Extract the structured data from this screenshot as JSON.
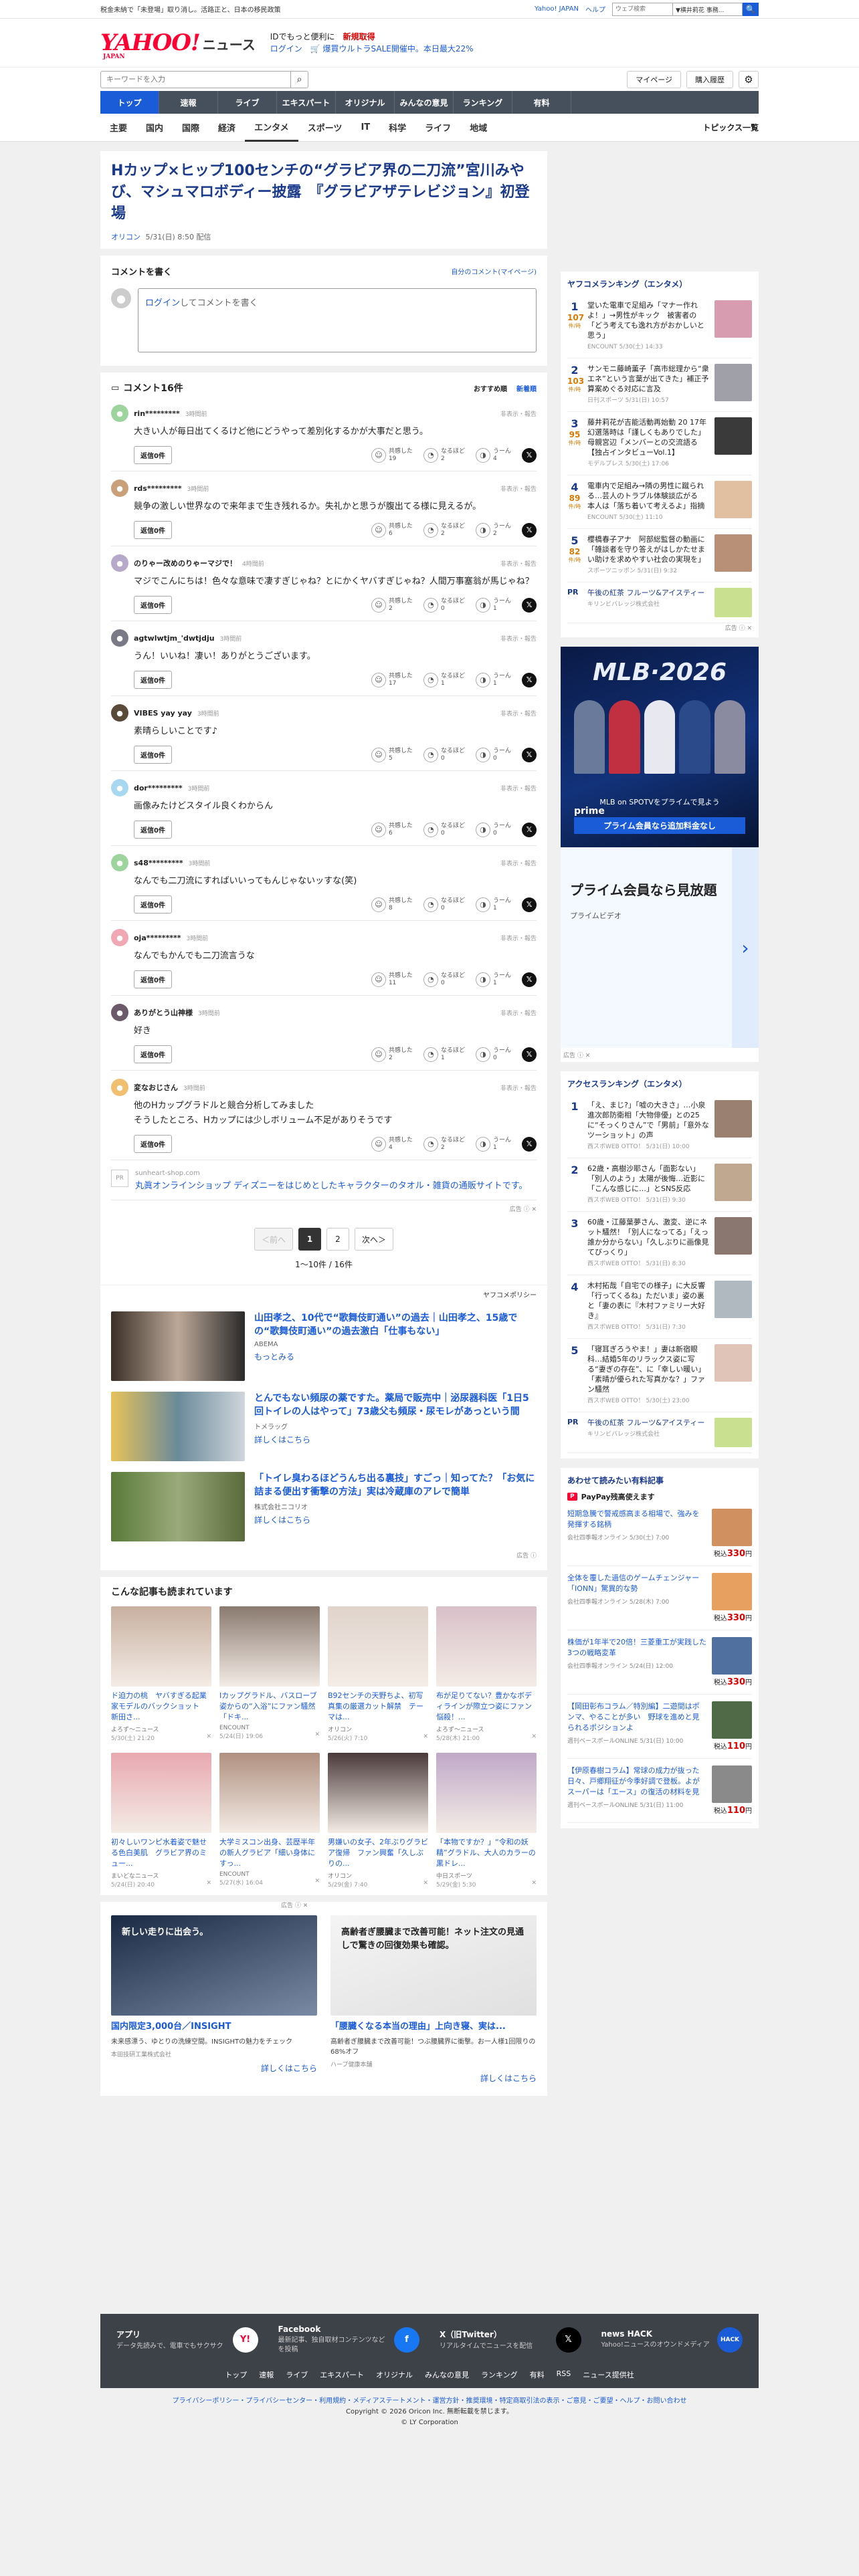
{
  "topbar": {
    "promo": "税金未納で「未登場」取り消し。活路正と、日本の移民政策",
    "links": [
      "Yahoo! JAPAN",
      "ヘルプ"
    ],
    "search_placeholder": "ウェブ検索",
    "search_scope": "▼横井莉花 事務...",
    "search_button": "🔍"
  },
  "header": {
    "logo_yahoo": "YAHOO!",
    "logo_japan": "JAPAN",
    "logo_news": "ニュース",
    "ad_line1_a": "IDでもっと便利に",
    "ad_line1_b": "新規取得",
    "ad_line2_a": "ログイン",
    "ad_line2_b": "🛒 爆買ウルトラSALE開催中。本日最大22%"
  },
  "searchrow": {
    "placeholder": "キーワードを入力",
    "mypage": "マイページ",
    "history": "購入履歴",
    "gear": "⚙"
  },
  "nav": {
    "tabs": [
      "トップ",
      "速報",
      "ライブ",
      "エキスパート",
      "オリジナル",
      "みんなの意見",
      "ランキング",
      "有料"
    ],
    "sub": [
      "主要",
      "国内",
      "国際",
      "経済",
      "エンタメ",
      "スポーツ",
      "IT",
      "科学",
      "ライフ",
      "地域"
    ],
    "topics": "トピックス一覧"
  },
  "article": {
    "title": "Hカップ×ヒップ100センチの“グラビア界の二刀流”宮川みやび、マシュマロボディー披露　『グラビアザテレビジョン』初登場",
    "source": "オリコン",
    "date": "5/31(日) 8:50 配信"
  },
  "commentbox": {
    "title": "コメントを書く",
    "mine": "自分のコメント(マイページ)",
    "login": "ログイン",
    "placeholder": "してコメントを書く"
  },
  "comments": {
    "count_label": "コメント16件",
    "sort_recommended": "おすすめ順",
    "sort_new": "新着順",
    "report": "非表示・報告",
    "reply_label": "返信0件",
    "react_labels": [
      "共感した",
      "なるほど",
      "うーん"
    ],
    "items": [
      {
        "name": "rin*********",
        "time": "3時間前",
        "body": "大きい人が毎日出てくるけど他にどうやって差別化するかが大事だと思う。",
        "r": [
          "19",
          "2",
          "4"
        ],
        "av": "#9dd49d"
      },
      {
        "name": "rds*********",
        "time": "3時間前",
        "body": "競争の激しい世界なので来年まで生き残れるか。失礼かと思うが腹出てる様に見えるが。",
        "r": [
          "6",
          "2",
          "2"
        ],
        "av": "#c9a07a"
      },
      {
        "name": "のりゃー改めのりゃーマジで！",
        "time": "4時間前",
        "body": "マジでこんにちは！色々な意味で凄すぎじゃね？とにかくヤバすぎじゃね？人間万事塞翁が馬じゃね？",
        "r": [
          "2",
          "0",
          "1"
        ],
        "av": "#b7a9c9"
      },
      {
        "name": "agtwlwtjm_'dwtjdju",
        "time": "3時間前",
        "body": "うん！いいね！凄い！ありがとうございます。",
        "r": [
          "17",
          "1",
          "1"
        ],
        "av": "#7a7a86"
      },
      {
        "name": "VIBES yay yay",
        "time": "3時間前",
        "body": "素晴らしいことです♪",
        "r": [
          "5",
          "0",
          "0"
        ],
        "av": "#5a4a3a"
      },
      {
        "name": "dor*********",
        "time": "3時間前",
        "body": "画像みたけどスタイル良くわからん",
        "r": [
          "6",
          "0",
          "0"
        ],
        "av": "#a8d8f0"
      },
      {
        "name": "s48*********",
        "time": "3時間前",
        "body": "なんでも二刀流にすればいいってもんじゃないッすな(笑)",
        "r": [
          "8",
          "0",
          "1"
        ],
        "av": "#9dd49d"
      },
      {
        "name": "oja*********",
        "time": "3時間前",
        "body": "なんでもかんでも二刀流言うな",
        "r": [
          "11",
          "0",
          "1"
        ],
        "av": "#f0a8b4"
      },
      {
        "name": "ありがとう山神様",
        "time": "3時間前",
        "body": "好き",
        "r": [
          "2",
          "1",
          "0"
        ],
        "av": "#6a5a6a"
      },
      {
        "name": "変なおじさん",
        "time": "3時間前",
        "body": "他のHカップグラドルと競合分析してみました\nそうしたところ、Hカップには少しボリューム不足がありそうです",
        "r": [
          "4",
          "2",
          "1"
        ],
        "av": "#f0c070"
      }
    ],
    "ad_domain": "sunheart-shop.com",
    "ad_text": "丸眞オンラインショップ ディズニーをはじめとしたキャラクターのタオル・雑貨の通販サイトです。",
    "ad_label": "広告 ⓘ ✕"
  },
  "pager": {
    "prev": "＜前へ",
    "pages": [
      "1",
      "2"
    ],
    "next": "次へ＞",
    "count": "1〜10件 / 16件"
  },
  "policy": "ヤフコメポリシー",
  "adarticles": [
    {
      "title": "山田孝之、10代で“歌舞伎町通い”の過去｜山田孝之、15歳での“歌舞伎町通い”の過去激白「仕事もない」",
      "sponsor": "ABEMA",
      "more": "もっとみる",
      "color": "linear-gradient(90deg,#3a3028,#bca898 50%,#2a2a2a)"
    },
    {
      "title": "とんでもない頻尿の薬ですた。薬局で販売中｜泌尿器科医「1日5回トイレの人はやって」73歳父も頻尿・尿モレがあっという間",
      "sponsor": "トメラッグ",
      "more": "詳しくはこちら",
      "color": "linear-gradient(90deg,#e8c25a,#6a8a9a 50%,#d0d6dc)"
    },
    {
      "title": "「トイレ臭わるほどうんち出る裏技」すごっ｜知ってた？「お気に詰まる便出す衝撃の方法」実は冷蔵庫のアレで簡単",
      "sponsor": "株式会社ニコリオ",
      "more": "詳しくはこちら",
      "color": "linear-gradient(90deg,#5a7a3a,#9aaa7a 50%,#5a6a3a)"
    }
  ],
  "adarticles_label": "広告 ⓘ",
  "alsoread": {
    "title": "こんな記事も読まれています",
    "items": [
      {
        "t": "ド迫力の桃　ヤバすぎる起業家モデルのバックショット　新田さ...",
        "s": "よろず～ニュース",
        "d": "5/30(土) 21:20",
        "c": "#c8b0a0"
      },
      {
        "t": "Iカップグラドル、バスローブ姿からの“入浴”にファン騒然「ドキ...",
        "s": "ENCOUNT",
        "d": "5/24(日) 19:06",
        "c": "#8a7a70"
      },
      {
        "t": "B92センチの天野ちよ、初写真集の厳選カット解禁　テーマは...",
        "s": "オリコン",
        "d": "5/26(火) 7:10",
        "c": "#e0d4cc"
      },
      {
        "t": "布が足りてない？豊かなボディラインが際立つ姿にファン悩殺！...",
        "s": "よろず～ニュース",
        "d": "5/28(木) 21:00",
        "c": "#d8c0c8"
      },
      {
        "t": "初々しいワンピ水着姿で魅せる色白美肌　グラビア界のミュー...",
        "s": "まいどなニュース",
        "d": "5/24(日) 20:40",
        "c": "#e8a8b0"
      },
      {
        "t": "大学ミスコン出身、芸歴半年の新人グラビア「細い身体にすっ...",
        "s": "ENCOUNT",
        "d": "5/27(水) 16:04",
        "c": "#b09080"
      },
      {
        "t": "男嫌いの女子、2年ぶりグラビア復帰　ファン興奮「久しぶりの...",
        "s": "オリコン",
        "d": "5/29(金) 7:40",
        "c": "#4a3a3a"
      },
      {
        "t": "「本物ですか？」“令和の妖精”グラドル、大人のカラーの黒ドレ...",
        "s": "中日スポーツ",
        "d": "5/29(金) 5:30",
        "c": "#c0a8c8"
      }
    ]
  },
  "bottomads": {
    "label": "広告 ⓘ ✕",
    "items": [
      {
        "t": "国内限定3,000台／INSIGHT",
        "d": "未来感漂う、ゆとりの洗練空間。INSIGHTの魅力をチェック",
        "s": "本田技研工業株式会社",
        "m": "詳しくはこちら",
        "c": "linear-gradient(160deg,#1a2a44,#7a8aa4)",
        "overlay": "新しい走りに出会う。"
      },
      {
        "t": "「腰臓くなる本当の理由」上向き寝、実は...",
        "d": "高齢者ぎ腰臓まで改善可能！つぶ腰臓界に衝撃。お一人様1回限りの68%オフ",
        "s": "ハーブ健康本舗",
        "m": "詳しくはこちら",
        "c": "linear-gradient(160deg,#f4f4f4,#e0e0e0)",
        "overlay": "高齢者ぎ腰臓まで改善可能！ネット注文の見通しで驚きの回復効果も確認。"
      }
    ]
  },
  "side": {
    "ranking_title": "ヤフコメランキング（エンタメ）",
    "rank_unit": "件/時",
    "ranking": [
      {
        "n": "1",
        "c": "107",
        "t": "堂いた電車で足組み「マナー作れよ！」→男性がキック　被害者の「どう考えても逸れ方がおかしいと思う」",
        "s": "ENCOUNT 5/30(土) 14:33",
        "img": "#d89cb0"
      },
      {
        "n": "2",
        "c": "103",
        "t": "サンモニ藤崎薫子「高市総理から“衆エネ”という言葉が出てきた」補正予算案めぐる対応に言及",
        "s": "日刊スポーツ 5/31(日) 10:57",
        "img": "#a0a0a8"
      },
      {
        "n": "3",
        "c": "95",
        "t": "藤井莉花が吉能活動再始動 20 17年幻選落時は「謹しくもありでした」母親宮辺「メンバーとの交流語る【独占インタビューVol.1】",
        "s": "モデルプレス 5/30(土) 17:06",
        "img": "#3a3a3a"
      },
      {
        "n": "4",
        "c": "89",
        "t": "電車内で足組み→隣の男性に蹴られる…芸人のトラブル体験談広がる　本人は「落ち着いて考えるよ」指摘",
        "s": "ENCOUNT 5/30(土) 11:10",
        "img": "#e0c0a0"
      },
      {
        "n": "5",
        "c": "82",
        "t": "櫻橋春子アナ　阿部総監督の動画に「雑談者を守り答えがはしかたせまい助けを求めやすい社会の実現を」",
        "s": "スポーツニッポン 5/31(日) 9:32",
        "img": "#b89078"
      }
    ],
    "ranking_pr": {
      "t": "午後の紅茶 フルーツ&アイスティー",
      "s": "キリンビバレッジ株式会社",
      "img": "#c8e090"
    },
    "ad_label": "広告 ⓘ ✕",
    "mlb": {
      "title": "MLB·2026",
      "line1": "MLB on SPOTVをプライムで見よう",
      "prime": "prime",
      "line2": "プライム会員なら追加料金なし",
      "card_title": "プライム会員なら見放題",
      "card_sub": "プライムビデオ",
      "arrow": "›"
    },
    "access_title": "アクセスランキング（エンタメ）",
    "access": [
      {
        "n": "1",
        "t": "「え、まじ?」「嘘の大きさ」…小泉進次郎防衛相「大物俳優」との25に“そっくりさん”で「男前」「意外なツーショット」の声",
        "s": "西スポWEB OTTO！ 5/31(日) 10:00",
        "img": "#9a8070"
      },
      {
        "n": "2",
        "t": "62歳・高樹沙耶さん「面影ない」「別人のよう」太陽が後悔…近影に「こんな感じに…」とSNS反応",
        "s": "西スポWEB OTTO！ 5/31(日) 9:30",
        "img": "#c0a890"
      },
      {
        "n": "3",
        "t": "60歳・江藤葉夢さん、激変、逆にネット騒然！「別人になってる」「えっ誰か分からない」「久しぶりに画像見てびっくり」",
        "s": "西スポWEB OTTO！ 5/31(日) 8:30",
        "img": "#8a7870"
      },
      {
        "n": "4",
        "t": "木村拓哉「自宅での様子」に大反響「行ってくるね」ただいま」姿の裏と「妻の表に『木村ファミリー大好き』",
        "s": "西スポWEB OTTO！ 5/31(日) 7:30",
        "img": "#b0b8c0"
      },
      {
        "n": "5",
        "t": "「寝耳ぎろうやま！」妻は新宿眼科…結婚5年のリラックス姿に写る“妻ぎの存在”、に「幸しい暖い」「素晴が優られた写真かな？」ファン騒然",
        "s": "西スポWEB OTTO！ 5/30(土) 23:00",
        "img": "#e0c4b8"
      }
    ],
    "access_pr": {
      "t": "午後の紅茶 フルーツ&アイスティー",
      "s": "キリンビバレッジ株式会社",
      "img": "#c8e090"
    },
    "paid_title": "あわせて読みたい有料記事",
    "paypay": "PayPay残高使えます",
    "paypay_badge": "P",
    "price_prefix": "税込",
    "paid": [
      {
        "t": "短期急騰で警戒感高まる相場で、強みを発揮する銘柄",
        "s": "会社四季報オンライン 5/30(土) 7:00",
        "p": "330",
        "img": "#d09060"
      },
      {
        "t": "全体を覆した過信のゲームチェンジャー「IONN」驚異的な勢",
        "s": "会社四季報オンライン 5/28(木) 7:00",
        "p": "330",
        "img": "#e8a060"
      },
      {
        "t": "株価が1年半で20倍！三菱重工が実践した3つの戦略変革",
        "s": "会社四季報オンライン 5/24(日) 12:00",
        "p": "330",
        "img": "#5070a0"
      },
      {
        "t": "【岡田彰布コラム／特別編】二遊間はポンマ、やることが多い　野球を進めと見られるポジションよ",
        "s": "週刊ベースボールONLINE 5/31(日) 10:00",
        "p": "110",
        "img": "#506a48"
      },
      {
        "t": "【伊原春樹コラム】常球の成力が抜った日々、戸郷翔征が今季好調で登板。よがスーパーは「エース」の復活の材料を見",
        "s": "週刊ベースボールONLINE 5/31(日) 11:00",
        "p": "110",
        "img": "#8a8a8a"
      }
    ],
    "price_unit": "円"
  },
  "footer": {
    "apps": [
      {
        "t": "アプリ",
        "d": "データ先読みで、電車でもサクサク",
        "ic": "Y!",
        "bg": "#fff",
        "fg": "#ff0033"
      },
      {
        "t": "Facebook",
        "d": "最新記事、独自取材コンテンツなどを投稿",
        "ic": "f",
        "bg": "#1877f2",
        "fg": "#fff"
      },
      {
        "t": "X（旧Twitter）",
        "d": "リアルタイムでニュースを配信",
        "ic": "𝕏",
        "bg": "#000",
        "fg": "#fff"
      },
      {
        "t": "news HACK",
        "d": "Yahoo!ニュースのオウンドメディア",
        "ic": "HACK",
        "bg": "#1a5bd8",
        "fg": "#fff"
      }
    ],
    "links": [
      "トップ",
      "速報",
      "ライブ",
      "エキスパート",
      "オリジナル",
      "みんなの意見",
      "ランキング",
      "有料",
      "RSS",
      "ニュース提供社"
    ],
    "policy": "プライバシーポリシー・プライバシーセンター・利用規約・メディアステートメント・運営方針・推奨環境・特定商取引法の表示・ご意見・ご要望・ヘルプ・お問い合わせ",
    "copyright": "Copyright © 2026 Oricon Inc. 無断転載を禁じます。",
    "corp": "© LY Corporation"
  }
}
